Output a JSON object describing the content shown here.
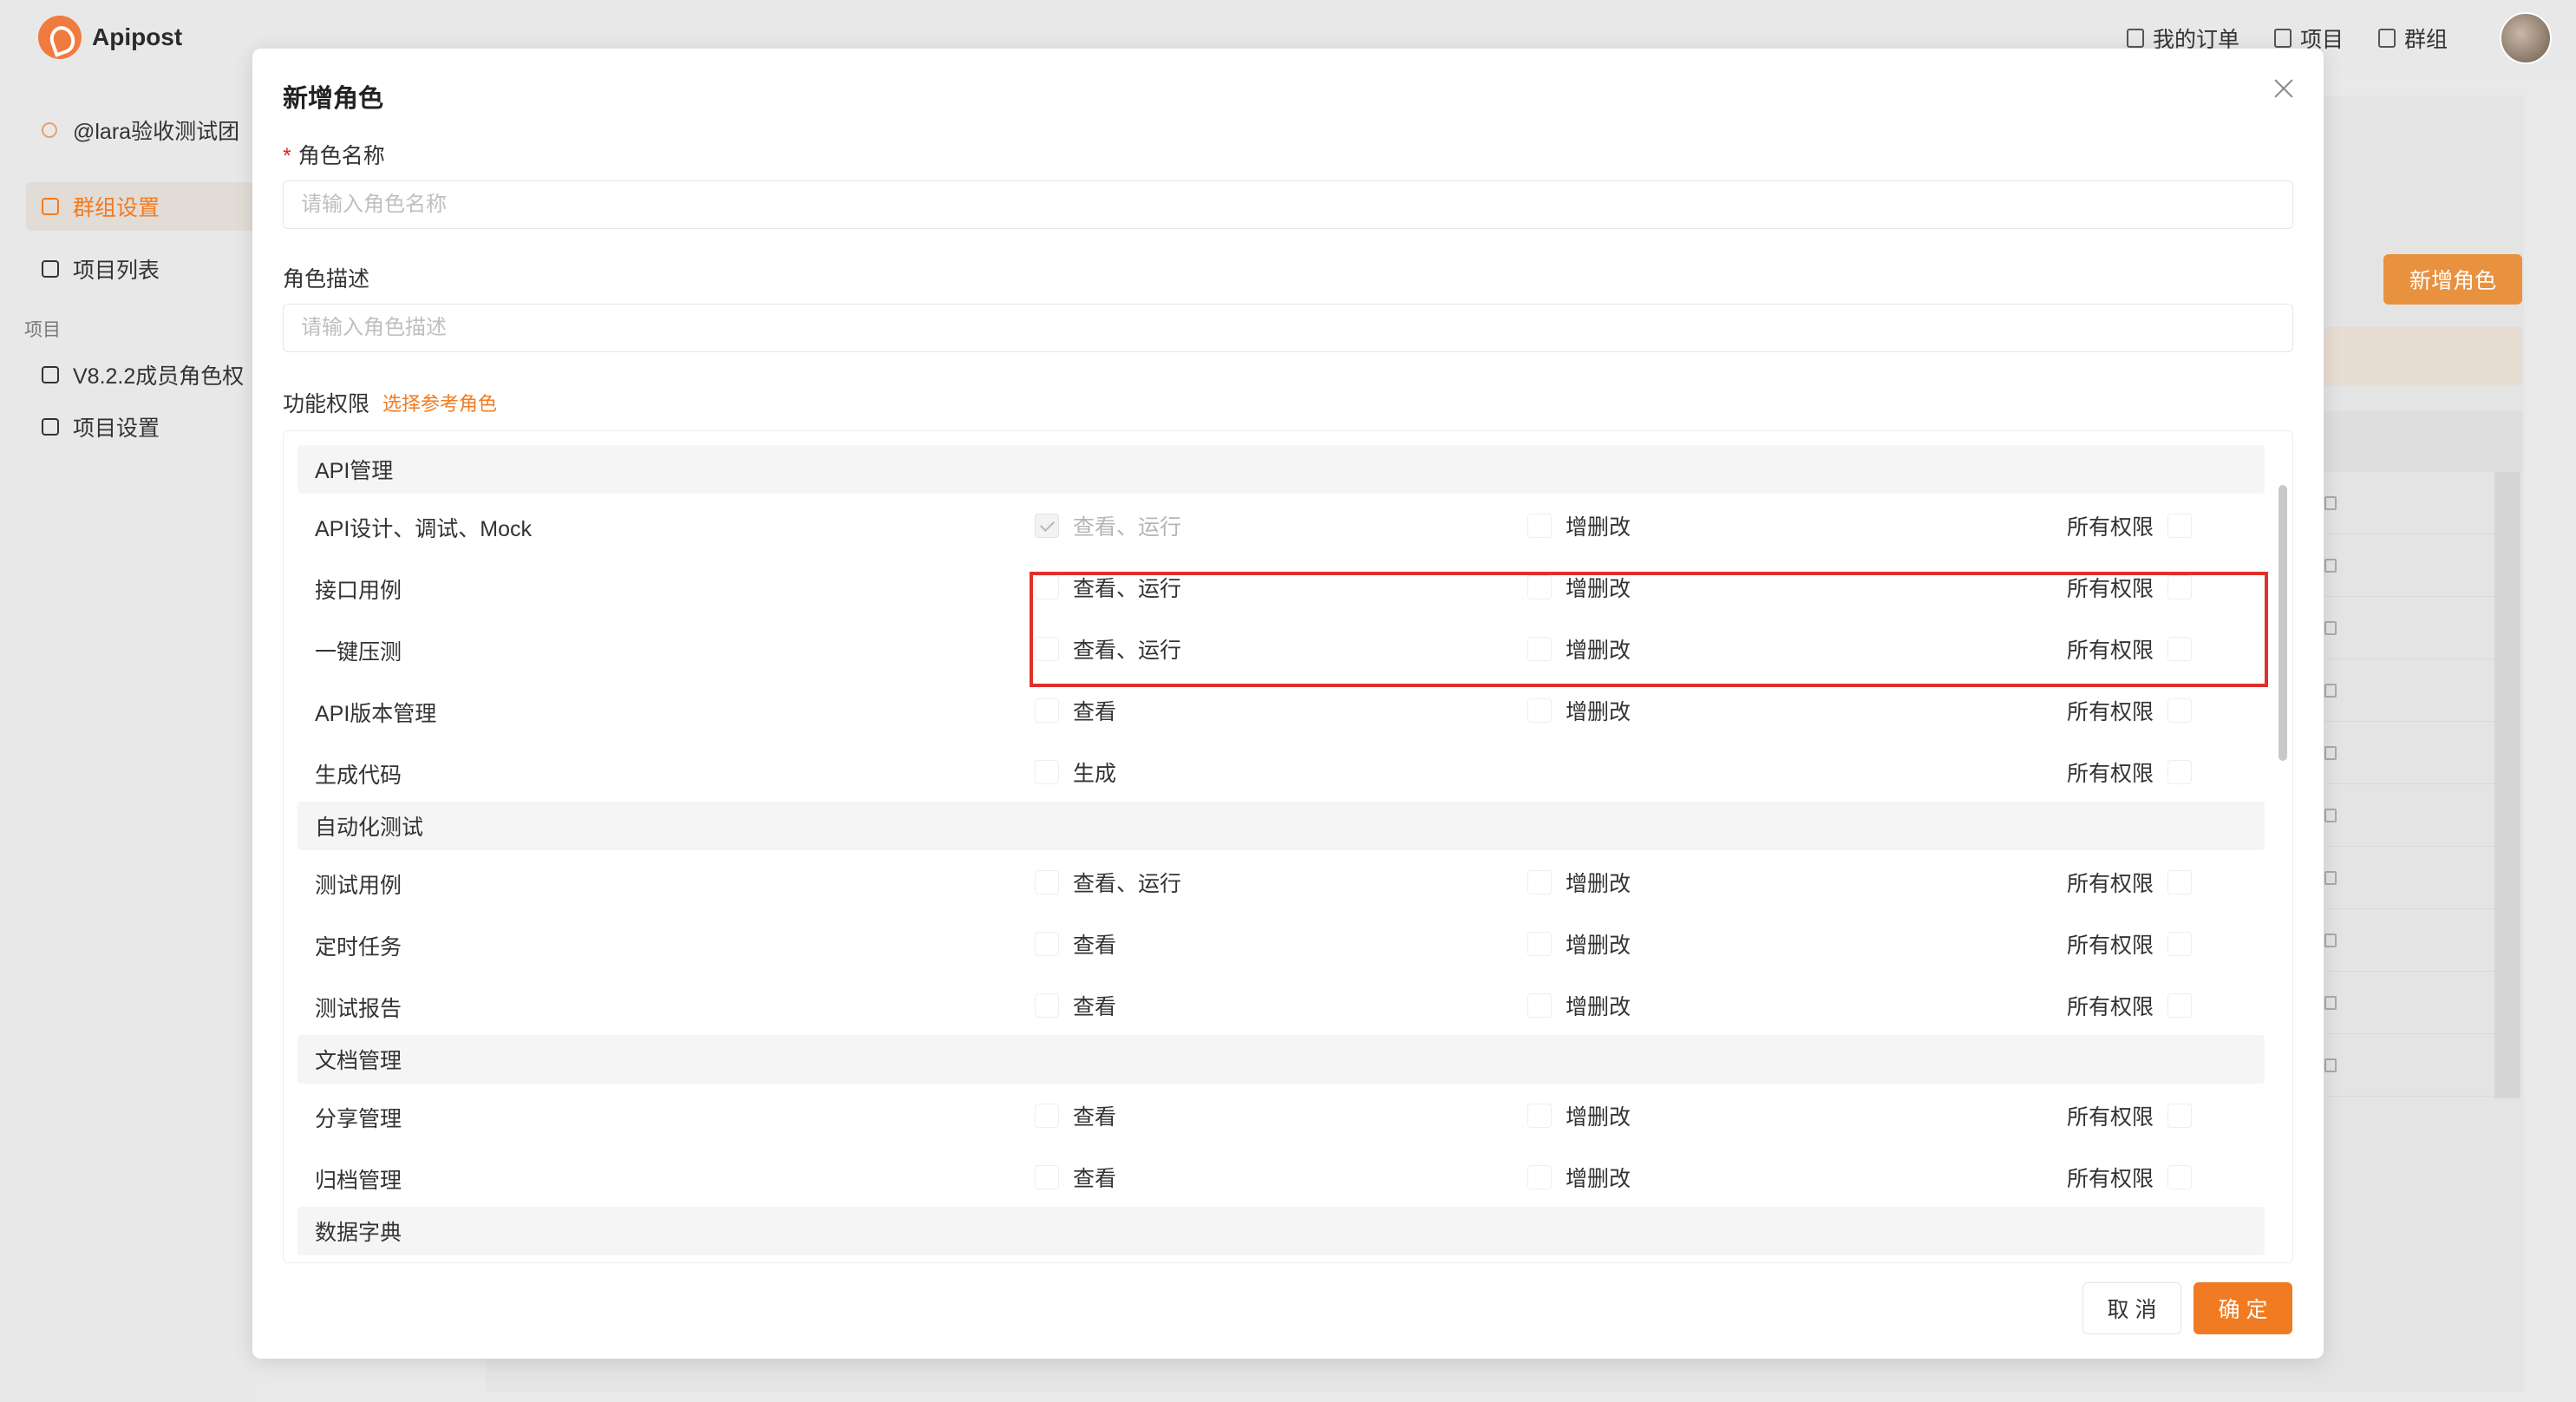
{
  "app": {
    "name": "Apipost"
  },
  "topnav": {
    "orders": "我的订单",
    "projects": "项目",
    "groups": "群组"
  },
  "sidebar": {
    "team": "@lara验收测试团",
    "items": [
      {
        "label": "群组设置",
        "active": true
      },
      {
        "label": "项目列表",
        "active": false
      }
    ],
    "section_label": "项目",
    "project_items": [
      {
        "label": "V8.2.2成员角色权"
      },
      {
        "label": "项目设置"
      }
    ]
  },
  "background": {
    "new_role_button": "新增角色"
  },
  "modal": {
    "title": "新增角色",
    "role_name": {
      "label": "角色名称",
      "required_mark": "*",
      "placeholder": "请输入角色名称",
      "value": ""
    },
    "role_desc": {
      "label": "角色描述",
      "placeholder": "请输入角色描述",
      "value": ""
    },
    "permissions": {
      "label": "功能权限",
      "reference_link": "选择参考角色",
      "groups": [
        {
          "title": "API管理",
          "rows": [
            {
              "label": "API设计、调试、Mock",
              "view": "查看、运行",
              "edit": "增删改",
              "all": "所有权限"
            },
            {
              "label": "接口用例",
              "view": "查看、运行",
              "edit": "增删改",
              "all": "所有权限"
            },
            {
              "label": "一键压测",
              "view": "查看、运行",
              "edit": "增删改",
              "all": "所有权限"
            },
            {
              "label": "API版本管理",
              "view": "查看",
              "edit": "增删改",
              "all": "所有权限"
            },
            {
              "label": "生成代码",
              "view": "生成",
              "all": "所有权限"
            }
          ]
        },
        {
          "title": "自动化测试",
          "rows": [
            {
              "label": "测试用例",
              "view": "查看、运行",
              "edit": "增删改",
              "all": "所有权限"
            },
            {
              "label": "定时任务",
              "view": "查看",
              "edit": "增删改",
              "all": "所有权限"
            },
            {
              "label": "测试报告",
              "view": "查看",
              "edit": "增删改",
              "all": "所有权限"
            }
          ]
        },
        {
          "title": "文档管理",
          "rows": [
            {
              "label": "分享管理",
              "view": "查看",
              "edit": "增删改",
              "all": "所有权限"
            },
            {
              "label": "归档管理",
              "view": "查看",
              "edit": "增删改",
              "all": "所有权限"
            }
          ]
        },
        {
          "title": "数据字典",
          "rows": []
        }
      ]
    },
    "buttons": {
      "cancel": "取 消",
      "ok": "确 定"
    }
  },
  "colors": {
    "accent": "#f07b22",
    "highlight": "#e0302b"
  }
}
